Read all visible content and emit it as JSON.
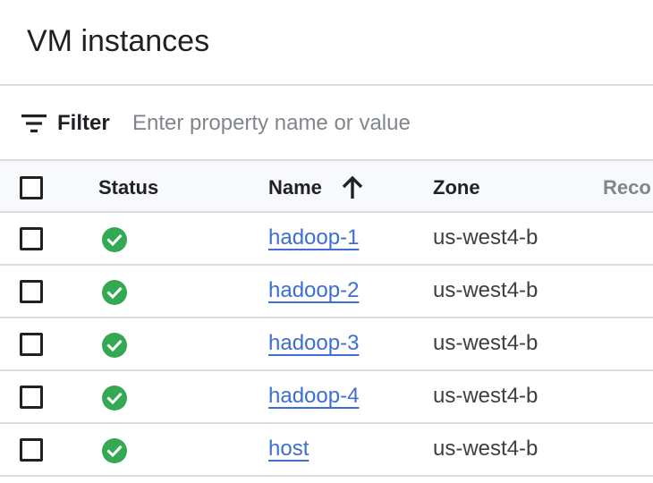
{
  "header": {
    "title": "VM instances"
  },
  "filter": {
    "label": "Filter",
    "placeholder": "Enter property name or value",
    "icon": "filter-list-icon"
  },
  "table": {
    "columns": {
      "status": "Status",
      "name": "Name",
      "zone": "Zone",
      "recommendation": "Reco"
    },
    "sort": {
      "column": "name",
      "direction": "ascending",
      "icon": "arrow-upward-icon"
    },
    "rows": [
      {
        "status": "running",
        "name": "hadoop-1",
        "zone": "us-west4-b"
      },
      {
        "status": "running",
        "name": "hadoop-2",
        "zone": "us-west4-b"
      },
      {
        "status": "running",
        "name": "hadoop-3",
        "zone": "us-west4-b"
      },
      {
        "status": "running",
        "name": "hadoop-4",
        "zone": "us-west4-b"
      },
      {
        "status": "running",
        "name": "host",
        "zone": "us-west4-b"
      }
    ]
  },
  "colors": {
    "link": "#3c6fcf",
    "status_ok": "#34a853",
    "border": "#dadce0",
    "header_bg": "#f8f9fa"
  }
}
